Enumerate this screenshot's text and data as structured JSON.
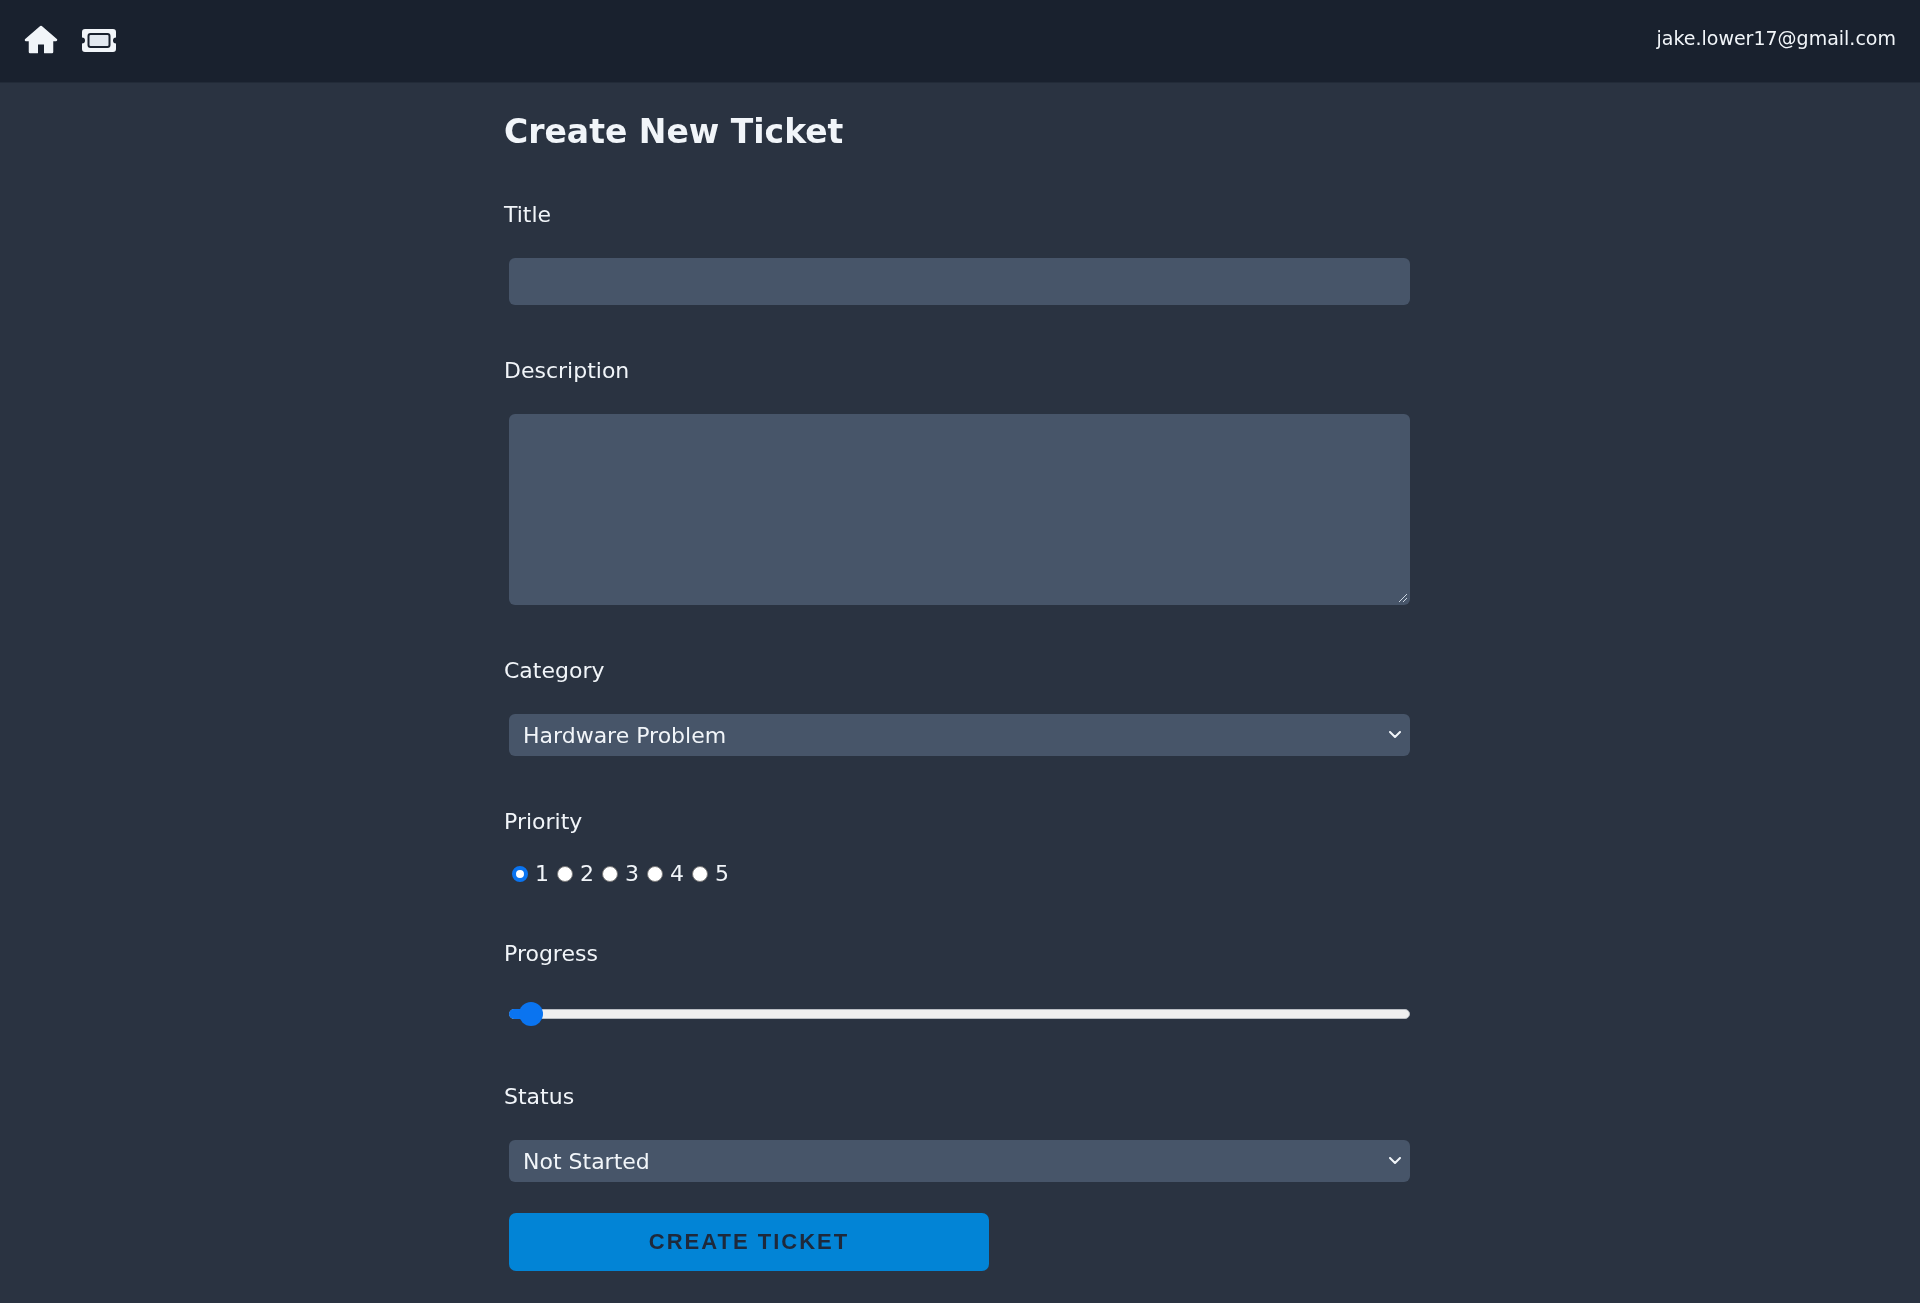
{
  "nav": {
    "user_email": "jake.lower17@gmail.com"
  },
  "form": {
    "heading": "Create New Ticket",
    "fields": [
      {
        "kind": "text",
        "label": "Title"
      },
      {
        "kind": "textarea",
        "label": "Description"
      },
      {
        "kind": "select",
        "label": "Category",
        "value": "Hardware Problem"
      },
      {
        "kind": "radio",
        "label": "Priority",
        "options": [
          {
            "label": "1",
            "selected": true
          },
          {
            "label": "2",
            "selected": false
          },
          {
            "label": "3",
            "selected": false
          },
          {
            "label": "4",
            "selected": false
          },
          {
            "label": "5",
            "selected": false
          }
        ]
      },
      {
        "kind": "range",
        "label": "Progress",
        "level": 0.01
      },
      {
        "kind": "select",
        "label": "Status",
        "value": "Not Started"
      }
    ],
    "submit_label": "CREATE TICKET"
  }
}
